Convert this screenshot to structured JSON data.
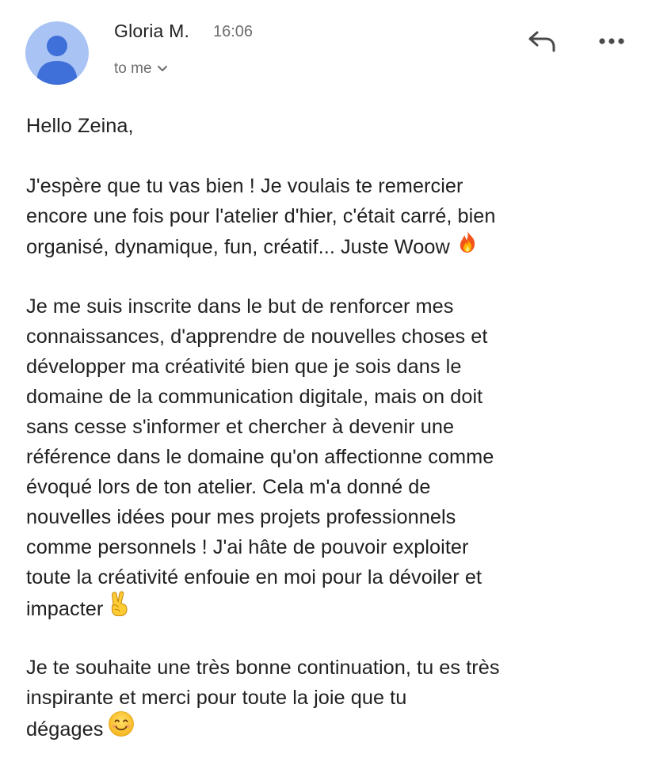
{
  "header": {
    "sender_name": "Gloria M.",
    "time": "16:06",
    "recipient_label": "to me",
    "avatar_color": "#a9c3f5",
    "avatar_figure_color": "#3f6fd8",
    "icons": {
      "avatar": "person-icon",
      "expand": "chevron-down-icon",
      "reply": "reply-icon",
      "more": "more-horizontal-icon"
    }
  },
  "message": {
    "greeting": "Hello Zeina,",
    "p1": {
      "l1": "J'espère que tu vas bien ! Je voulais te remercier",
      "l2": "encore une fois pour l'atelier d'hier, c'était carré, bien",
      "l3": "organisé, dynamique, fun, créatif... Juste Woow",
      "emoji": "fire-emoji"
    },
    "p2": {
      "l1": "Je me suis inscrite dans le but de renforcer mes",
      "l2": "connaissances, d'apprendre de nouvelles choses et",
      "l3": "développer ma créativité bien que je sois dans le",
      "l4": "domaine de la communication digitale, mais on doit",
      "l5": "sans cesse s'informer et chercher à devenir une",
      "l6": "référence dans le domaine qu'on affectionne comme",
      "l7": "évoqué lors de ton atelier. Cela m'a donné de",
      "l8": "nouvelles idées pour mes projets professionnels",
      "l9": "comme personnels ! J'ai hâte de pouvoir exploiter",
      "l10": "toute la créativité enfouie en moi pour la dévoiler et",
      "l11": "impacter",
      "emoji": "victory-hand-emoji"
    },
    "p3": {
      "l1": "Je te souhaite une très bonne continuation, tu es très",
      "l2": "inspirante et merci pour toute la joie que tu",
      "l3": "dégages",
      "emoji": "smiling-face-emoji"
    }
  }
}
